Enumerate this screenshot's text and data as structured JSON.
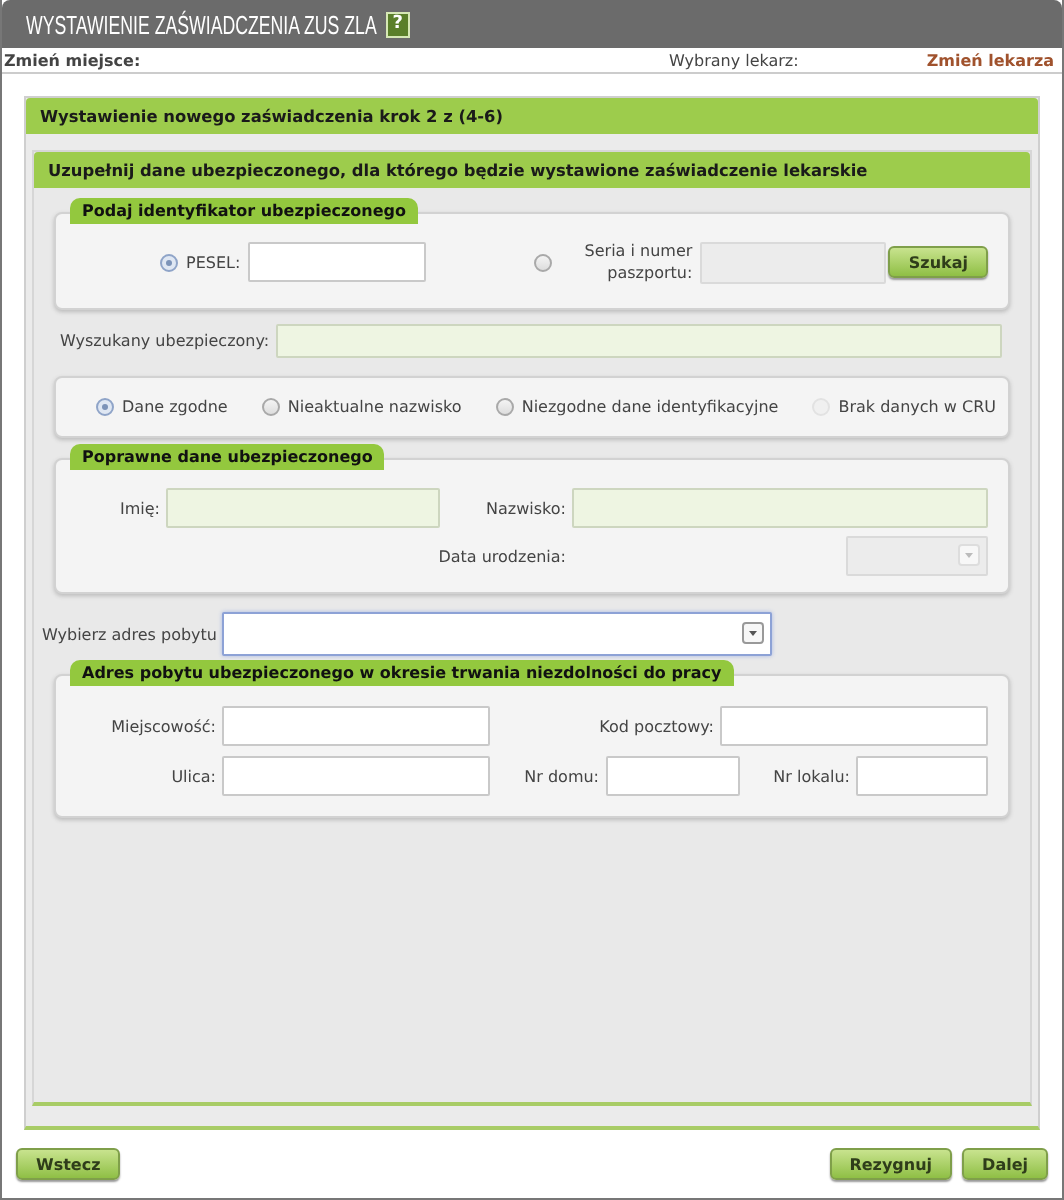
{
  "window": {
    "title": "WYSTAWIENIE ZAŚWIADCZENIA ZUS ZLA",
    "help_icon": "?"
  },
  "header": {
    "place_label": "Zmień miejsce:",
    "doctor_label": "Wybrany lekarz:",
    "change_doctor_link": "Zmień lekarza"
  },
  "step_title": "Wystawienie nowego zaświadczenia krok 2 z (4-6)",
  "panel_title": "Uzupełnij dane ubezpieczonego, dla którego będzie wystawione zaświadczenie lekarskie",
  "identifier": {
    "legend": "Podaj identyfikator ubezpieczonego",
    "options": [
      {
        "label": "PESEL:",
        "selected": true,
        "field": {
          "kind": "text",
          "readonly": false,
          "disabled": false
        }
      },
      {
        "label": "Seria i numer paszportu:",
        "selected": false,
        "field": {
          "kind": "text",
          "readonly": false,
          "disabled": true
        }
      }
    ],
    "search_button": "Szukaj"
  },
  "found": {
    "label": "Wyszukany ubezpieczony:",
    "field": {
      "kind": "text",
      "readonly": true,
      "disabled": false
    }
  },
  "status_options": [
    {
      "label": "Dane zgodne",
      "selected": true,
      "disabled": false
    },
    {
      "label": "Nieaktualne nazwisko",
      "selected": false,
      "disabled": false
    },
    {
      "label": "Niezgodne dane identyfikacyjne",
      "selected": false,
      "disabled": false
    },
    {
      "label": "Brak danych w CRU",
      "selected": false,
      "disabled": true
    }
  ],
  "corrected": {
    "legend": "Poprawne dane ubezpieczonego",
    "fields": [
      {
        "label": "Imię:",
        "kind": "text",
        "readonly": true,
        "disabled": false
      },
      {
        "label": "Nazwisko:",
        "kind": "text",
        "readonly": true,
        "disabled": false
      },
      {
        "label": "Data urodzenia:",
        "kind": "select",
        "readonly": false,
        "disabled": true
      }
    ]
  },
  "address_select": {
    "label": "Wybierz adres pobytu",
    "kind": "select",
    "readonly": false,
    "disabled": false,
    "focused": true
  },
  "address": {
    "legend": "Adres pobytu ubezpieczonego w okresie trwania niezdolności do pracy",
    "fields": [
      {
        "label": "Miejscowość:",
        "kind": "text",
        "readonly": false,
        "disabled": false
      },
      {
        "label": "Kod pocztowy:",
        "kind": "text",
        "readonly": false,
        "disabled": false
      },
      {
        "label": "Ulica:",
        "kind": "text",
        "readonly": false,
        "disabled": false
      },
      {
        "label": "Nr domu:",
        "kind": "text",
        "readonly": false,
        "disabled": false
      },
      {
        "label": "Nr lokalu:",
        "kind": "text",
        "readonly": false,
        "disabled": false
      }
    ]
  },
  "buttons": {
    "back": "Wstecz",
    "cancel": "Rezygnuj",
    "next": "Dalej"
  }
}
